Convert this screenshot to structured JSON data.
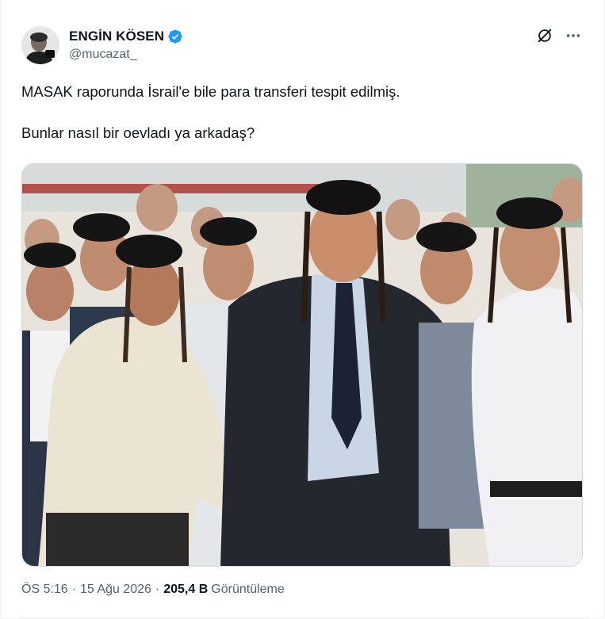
{
  "author": {
    "display_name": "ENGİN KÖSEN",
    "handle": "@mucazat_",
    "verified": true,
    "verified_color": "#1d9bf0",
    "avatar_icon": "user-avatar"
  },
  "actions": {
    "grok_icon": "grok-icon",
    "more_icon": "more-icon"
  },
  "tweet": {
    "paragraphs": [
      "MASAK raporunda İsrail'e bile para transferi tespit edilmiş.",
      "Bunlar nasıl bir oevladı ya arkadaş?"
    ]
  },
  "meta": {
    "time": "ÖS 5:16",
    "date": "15 Ağu 2026",
    "separator": "·",
    "views_count": "205,4 B",
    "views_label": "Görüntüleme"
  },
  "colors": {
    "text_primary": "#0f1419",
    "text_secondary": "#536471",
    "border": "#eff3f4"
  }
}
